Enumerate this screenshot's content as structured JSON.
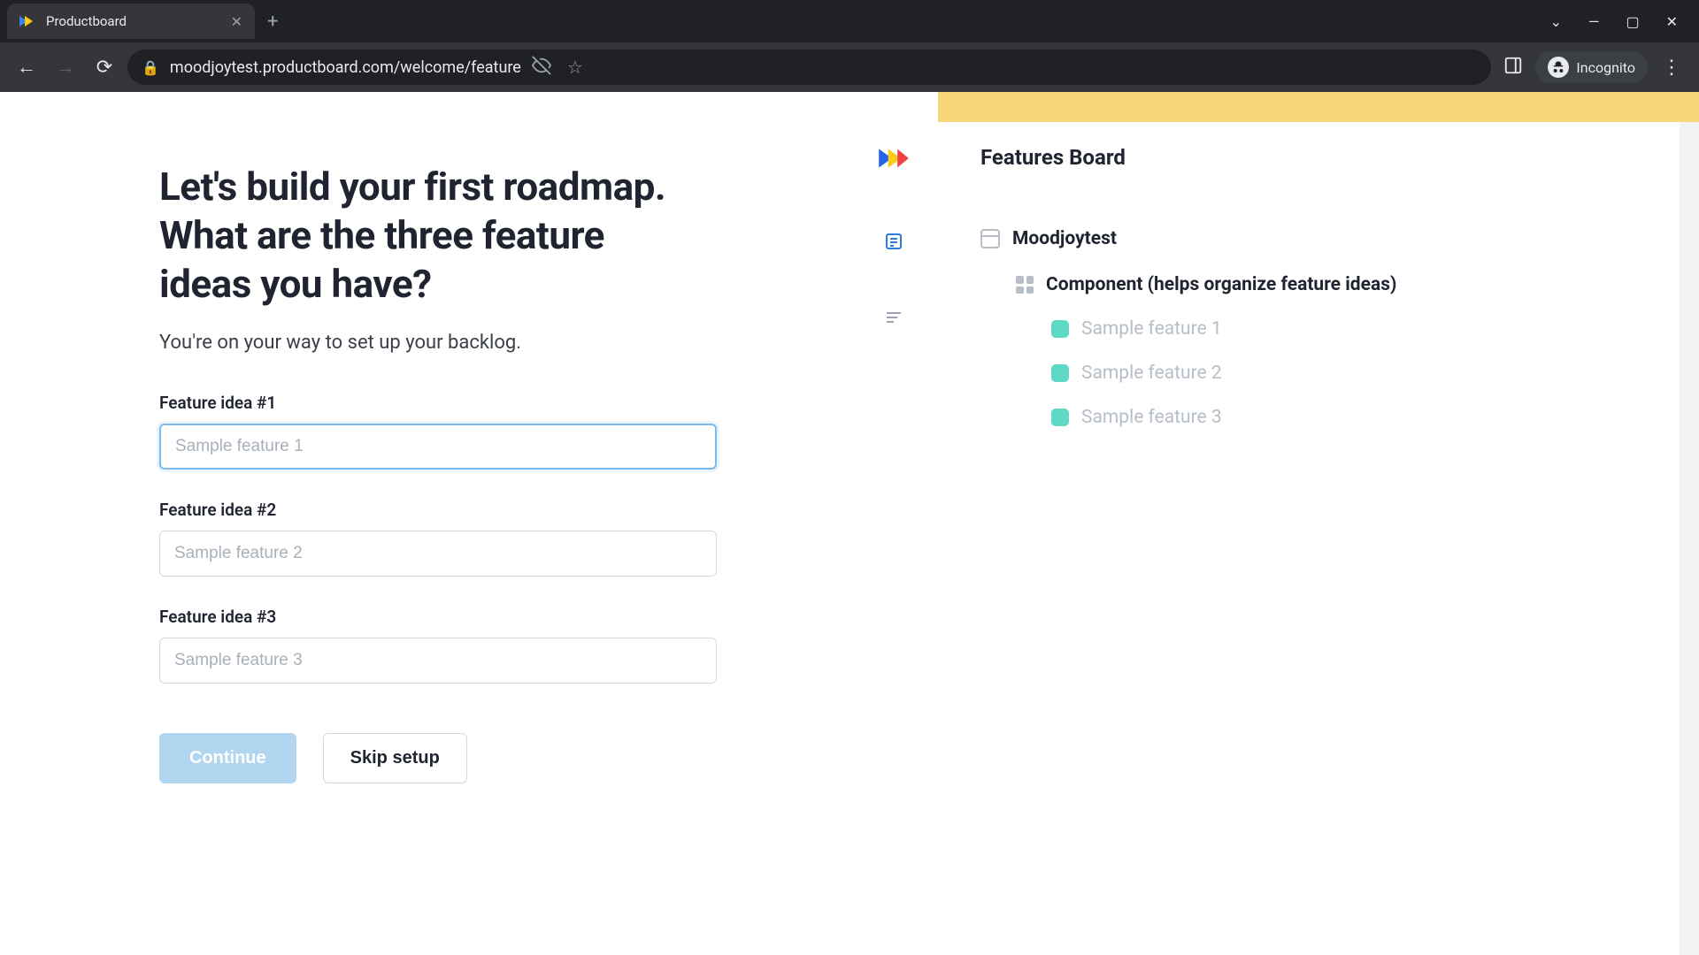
{
  "browser": {
    "tab_title": "Productboard",
    "url": "moodjoytest.productboard.com/welcome/feature",
    "incognito_label": "Incognito"
  },
  "onboarding": {
    "heading": "Let's build your first roadmap. What are the three feature ideas you have?",
    "subtext": "You're on your way to set up your backlog.",
    "fields": [
      {
        "label": "Feature idea #1",
        "placeholder": "Sample feature 1"
      },
      {
        "label": "Feature idea #2",
        "placeholder": "Sample feature 2"
      },
      {
        "label": "Feature idea #3",
        "placeholder": "Sample feature 3"
      }
    ],
    "continue_label": "Continue",
    "skip_label": "Skip setup"
  },
  "board": {
    "title": "Features Board",
    "project_name": "Moodjoytest",
    "component_label": "Component (helps organize feature ideas)",
    "features": [
      "Sample feature 1",
      "Sample feature 2",
      "Sample feature 3"
    ]
  }
}
